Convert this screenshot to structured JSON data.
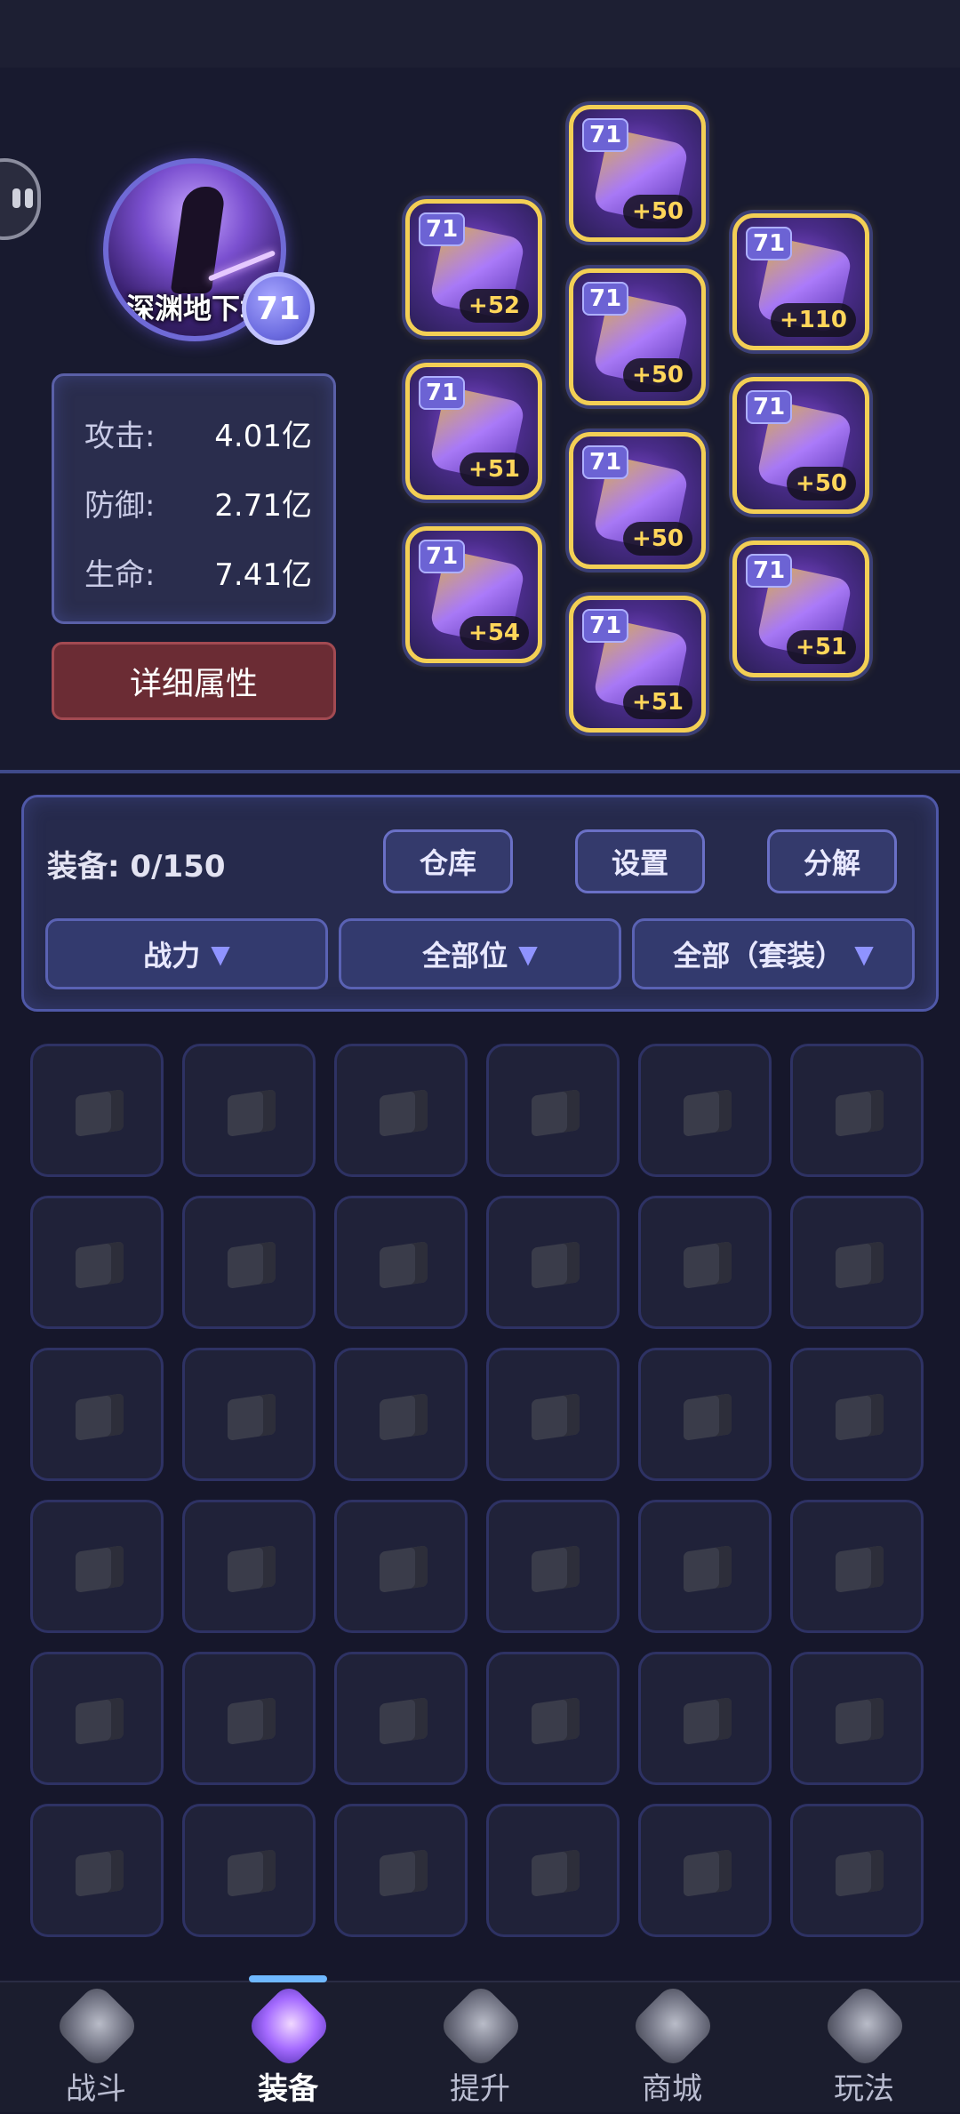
{
  "profile": {
    "level": "71",
    "avatar_text": "深渊地下城"
  },
  "stats": [
    {
      "label": "攻击:",
      "value": "4.01亿"
    },
    {
      "label": "防御:",
      "value": "2.71亿"
    },
    {
      "label": "生命:",
      "value": "7.41亿"
    }
  ],
  "detail_button": "详细属性",
  "equipped": [
    {
      "level": "71",
      "bonus": "+52"
    },
    {
      "level": "71",
      "bonus": "+51"
    },
    {
      "level": "71",
      "bonus": "+54"
    },
    {
      "level": "71",
      "bonus": "+50"
    },
    {
      "level": "71",
      "bonus": "+50"
    },
    {
      "level": "71",
      "bonus": "+50"
    },
    {
      "level": "71",
      "bonus": "+51"
    },
    {
      "level": "71",
      "bonus": "+110"
    },
    {
      "level": "71",
      "bonus": "+50"
    },
    {
      "level": "71",
      "bonus": "+51"
    }
  ],
  "bag": {
    "count_label": "装备: 0/150",
    "buttons": {
      "warehouse": "仓库",
      "settings": "设置",
      "decompose": "分解"
    },
    "filters": {
      "sort": "战力",
      "slot": "全部位",
      "set": "全部（套装）",
      "arrow": "▼"
    }
  },
  "nav": [
    {
      "label": "战斗"
    },
    {
      "label": "装备"
    },
    {
      "label": "提升"
    },
    {
      "label": "商城"
    },
    {
      "label": "玩法"
    }
  ],
  "colors": {
    "background": "#16172b",
    "equip_border": "#f3cf55",
    "bonus_text": "#ffd65a",
    "detail_button": "#6b2c34",
    "active_tab_indicator": "#6fb8ff"
  }
}
